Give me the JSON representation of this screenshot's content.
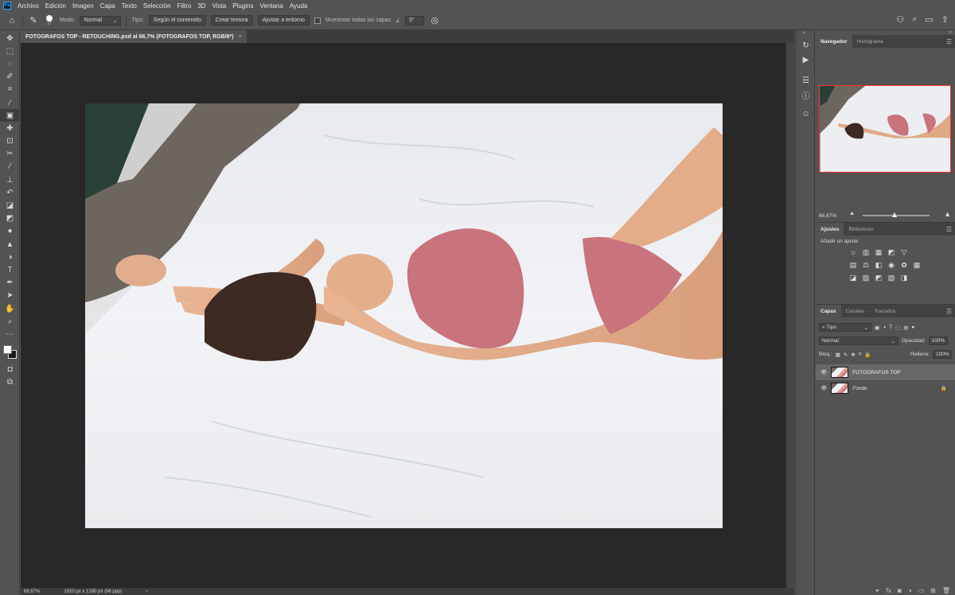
{
  "menubar": {
    "logo": "Ps",
    "items": [
      "Archivo",
      "Edición",
      "Imagen",
      "Capa",
      "Texto",
      "Selección",
      "Filtro",
      "3D",
      "Vista",
      "Plugins",
      "Ventana",
      "Ayuda"
    ]
  },
  "options": {
    "brush_size": "17",
    "mode_label": "Modo:",
    "mode_value": "Normal",
    "type_label": "Tipo:",
    "type_btn1": "Según el contenido",
    "type_btn2": "Crear textura",
    "type_btn3": "Ajustar a entorno",
    "sample_all": "Muestrear todas las capas",
    "angle": "0°"
  },
  "document": {
    "tab_title": "FOTOGRAFOS TOP - RETOUCHING.psd al 66,7% (FOTOGRAFOS TOP, RGB/8*)",
    "close": "×"
  },
  "status": {
    "zoom": "66,67%",
    "size": "1920 px x 1280 px (96 ppp)",
    "arrow": "›"
  },
  "navigator": {
    "tab1": "Navegador",
    "tab2": "Histograma",
    "zoom": "66,67%",
    "zoom_level": 0.67
  },
  "adjustments": {
    "tab1": "Ajustes",
    "tab2": "Bibliotecas",
    "hint": "Añadir un ajuste"
  },
  "layers": {
    "tab1": "Capas",
    "tab2": "Canales",
    "tab3": "Trazados",
    "filter": "Tipo",
    "blend": "Normal",
    "opacity_label": "Opacidad:",
    "opacity": "100%",
    "lock_label": "Bloq.:",
    "fill_label": "Relleno:",
    "fill": "100%",
    "items": [
      {
        "name": "FOTOGRAFOS TOP"
      },
      {
        "name": "Fondo"
      }
    ]
  },
  "colors": {
    "canvas_bg": "#282828",
    "ui_bg": "#535353",
    "nav_highlight": "#ff2d2d",
    "lingerie": "#c9737c"
  }
}
